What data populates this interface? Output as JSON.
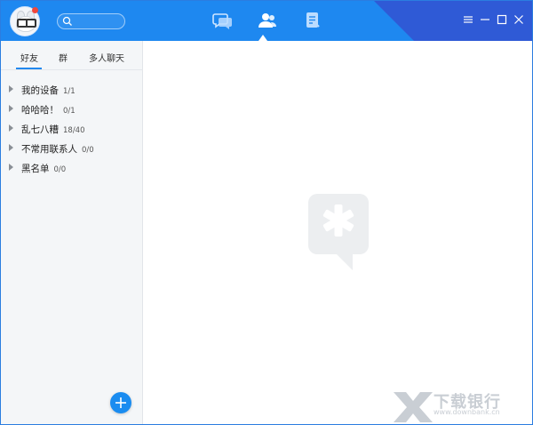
{
  "titlebar": {
    "search_placeholder": "",
    "nav": [
      "messages-icon",
      "contacts-icon",
      "documents-icon"
    ],
    "active_nav": "contacts-icon",
    "window_controls": [
      "menu-icon",
      "minimize-icon",
      "maximize-icon",
      "close-icon"
    ]
  },
  "sidebar": {
    "tabs": [
      "好友",
      "群",
      "多人聊天"
    ],
    "active_tab": "好友",
    "groups": [
      {
        "name": "我的设备",
        "count": "1/1",
        "expanded": false
      },
      {
        "name": "哈哈哈！",
        "count": "0/1",
        "expanded": false
      },
      {
        "name": "乱七八糟",
        "count": "18/40",
        "expanded": false
      },
      {
        "name": "不常用联系人",
        "count": "0/0",
        "expanded": false
      },
      {
        "name": "黑名单",
        "count": "0/0",
        "expanded": false
      }
    ],
    "add_button": "plus-icon"
  },
  "main": {
    "placeholder_logo": "tim-logo-icon"
  },
  "watermark": {
    "text": "下载银行",
    "url": "www.downbank.cn"
  },
  "colors": {
    "accent": "#1e88f0",
    "accent_dark": "#2f5ad6",
    "sidebar_bg": "#f4f6f8"
  }
}
